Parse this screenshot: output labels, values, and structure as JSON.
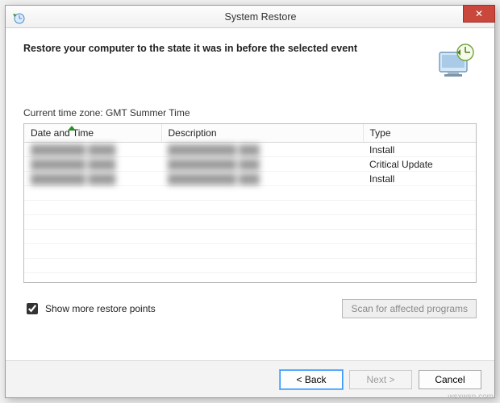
{
  "window": {
    "title": "System Restore",
    "close_glyph": "✕"
  },
  "headline": "Restore your computer to the state it was in before the selected event",
  "timezone_label": "Current time zone: GMT Summer Time",
  "table": {
    "columns": {
      "date": "Date and Time",
      "desc": "Description",
      "type": "Type"
    },
    "rows": [
      {
        "date": "████████ ████",
        "desc": "██████████ ███",
        "type": "Install"
      },
      {
        "date": "████████ ████",
        "desc": "██████████ ███",
        "type": "Critical Update"
      },
      {
        "date": "████████ ████",
        "desc": "██████████ ███",
        "type": "Install"
      }
    ]
  },
  "show_more": {
    "checked": true,
    "label": "Show more restore points"
  },
  "scan_button": "Scan for affected programs",
  "nav": {
    "back": "< Back",
    "next": "Next >",
    "cancel": "Cancel"
  },
  "watermark": "wsxwsn.com"
}
